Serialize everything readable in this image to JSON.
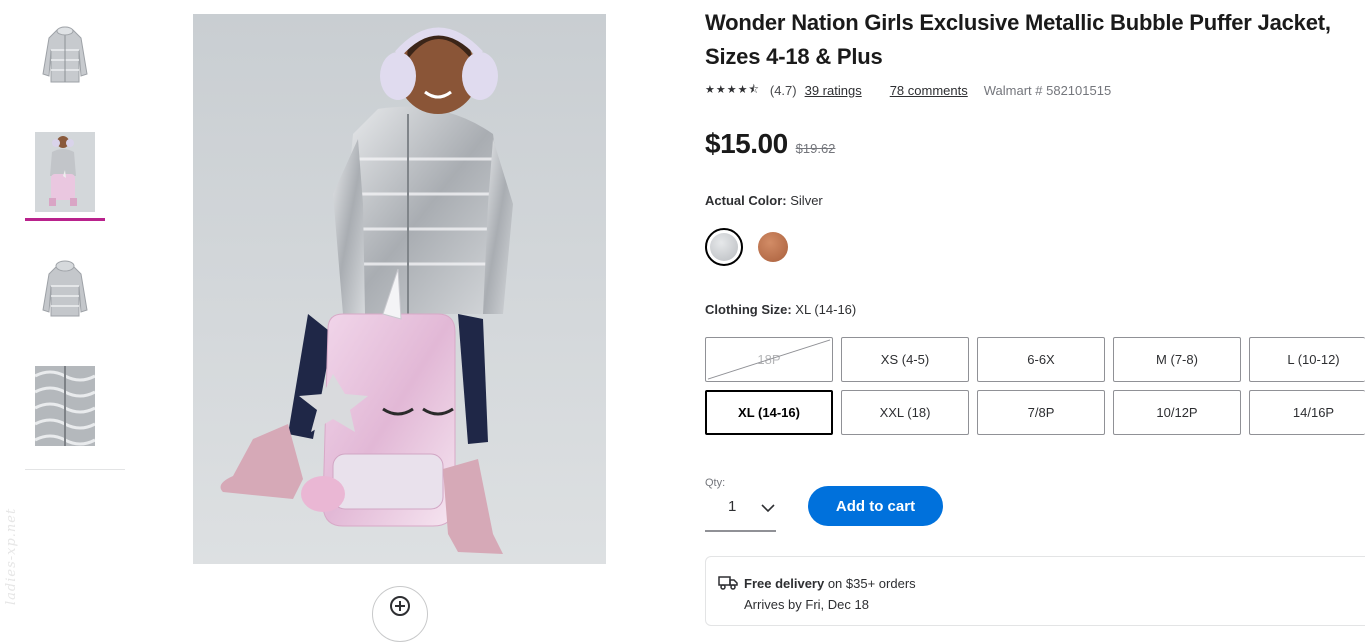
{
  "product": {
    "title": "Wonder Nation Girls Exclusive Metallic Bubble Puffer Jacket, Sizes 4-18 & Plus",
    "stars_display": "★★★★⯪",
    "rating_value": 4.7,
    "rating_text": "(4.7)",
    "ratings_link": "39 ratings",
    "comments_link": "78 comments",
    "item_number": "Walmart # 582101515",
    "price": "$15.00",
    "was_price": "$19.62"
  },
  "gallery": {
    "selected_index": 1,
    "thumbnails": [
      {
        "name": "jacket-front"
      },
      {
        "name": "child-model"
      },
      {
        "name": "jacket-back"
      },
      {
        "name": "fabric-detail"
      }
    ],
    "watermark": "ladies-xp.net"
  },
  "color": {
    "label": "Actual Color:",
    "value": "Silver",
    "swatches": [
      {
        "name": "Silver",
        "color": "#c4c7ca",
        "selected": true
      },
      {
        "name": "Bronze",
        "color": "#b96d48",
        "selected": false
      }
    ]
  },
  "size": {
    "label": "Clothing Size:",
    "value": "XL (14-16)",
    "options": [
      {
        "label": "18P",
        "unavailable": true
      },
      {
        "label": "XS (4-5)"
      },
      {
        "label": "6-6X"
      },
      {
        "label": "M (7-8)"
      },
      {
        "label": "L (10-12)"
      },
      {
        "label": "XL (14-16)",
        "selected": true
      },
      {
        "label": "XXL (18)"
      },
      {
        "label": "7/8P"
      },
      {
        "label": "10/12P"
      },
      {
        "label": "14/16P"
      }
    ]
  },
  "qty": {
    "label": "Qty:",
    "value": "1"
  },
  "cart": {
    "add_label": "Add to cart",
    "accent": "#0071dc"
  },
  "fulfillment": {
    "delivery_title": "Free delivery",
    "delivery_text": " on $35+ orders",
    "arrives": "Arrives by Fri, Dec 18"
  },
  "icons": [
    "zoom-in-icon",
    "chevron-down-icon",
    "truck-icon"
  ]
}
